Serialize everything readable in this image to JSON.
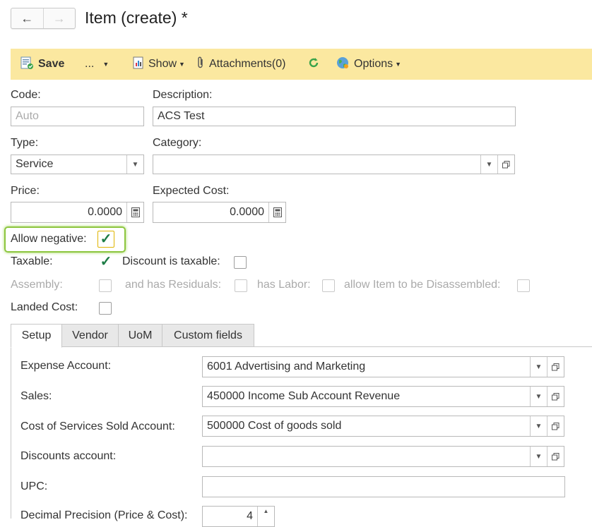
{
  "header": {
    "back_icon": "←",
    "forward_icon": "→",
    "title": "Item (create) *"
  },
  "toolbar": {
    "save_label": "Save",
    "more_label": "...",
    "show_label": "Show",
    "attachments_label": "Attachments(0)",
    "options_label": "Options",
    "bg_color": "#fbe8a0"
  },
  "form": {
    "code_label": "Code:",
    "code_placeholder": "Auto",
    "description_label": "Description:",
    "description_value": "ACS Test",
    "type_label": "Type:",
    "type_value": "Service",
    "category_label": "Category:",
    "category_value": "",
    "price_label": "Price:",
    "price_value": "0.0000",
    "expected_cost_label": "Expected Cost:",
    "expected_cost_value": "0.0000",
    "allow_negative_label": "Allow negative:",
    "allow_negative_checked": true,
    "taxable_label": "Taxable:",
    "taxable_checked": true,
    "discount_taxable_label": "Discount is taxable:",
    "discount_taxable_checked": false,
    "assembly_label": "Assembly:",
    "has_residuals_label": "and has Residuals:",
    "has_labor_label": "has Labor:",
    "allow_disassembled_label": "allow Item to be Disassembled:",
    "landed_cost_label": "Landed Cost:",
    "landed_cost_checked": false
  },
  "tabs": [
    {
      "label": "Setup",
      "active": true
    },
    {
      "label": "Vendor",
      "active": false
    },
    {
      "label": "UoM",
      "active": false
    },
    {
      "label": "Custom fields",
      "active": false
    }
  ],
  "setup": {
    "expense_label": "Expense Account:",
    "expense_value": "6001 Advertising and Marketing",
    "sales_label": "Sales:",
    "sales_value": "450000 Income Sub Account Revenue",
    "cost_label": "Cost of Services Sold Account:",
    "cost_value": "500000 Cost of goods sold",
    "discounts_label": "Discounts account:",
    "discounts_value": "",
    "upc_label": "UPC:",
    "upc_value": "",
    "precision_label": "Decimal Precision (Price & Cost):",
    "precision_value": "4"
  },
  "colors": {
    "highlight": "#8dc63f",
    "check": "#1e7d46"
  }
}
